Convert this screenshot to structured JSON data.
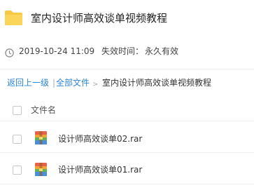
{
  "header": {
    "title": "室内设计师高效谈单视频教程",
    "icon": "folder-icon",
    "icon_color": "#f7c843"
  },
  "meta": {
    "date": "2019-10-24 11:09",
    "expire_label": "失效时间：",
    "expire_value": "永久有效"
  },
  "breadcrumb": {
    "back": "返回上一级",
    "sep": "|",
    "all": "全部文件",
    "arrow": ">",
    "current": "室内设计师高效谈单视频教程"
  },
  "table": {
    "column_header": "文件名",
    "files": [
      {
        "name": "设计师高效谈单02.rar",
        "icon": "rar-icon"
      },
      {
        "name": "设计师高效谈单01.rar",
        "icon": "rar-icon"
      }
    ]
  },
  "colors": {
    "link": "#2d84d8",
    "text": "#333333"
  }
}
